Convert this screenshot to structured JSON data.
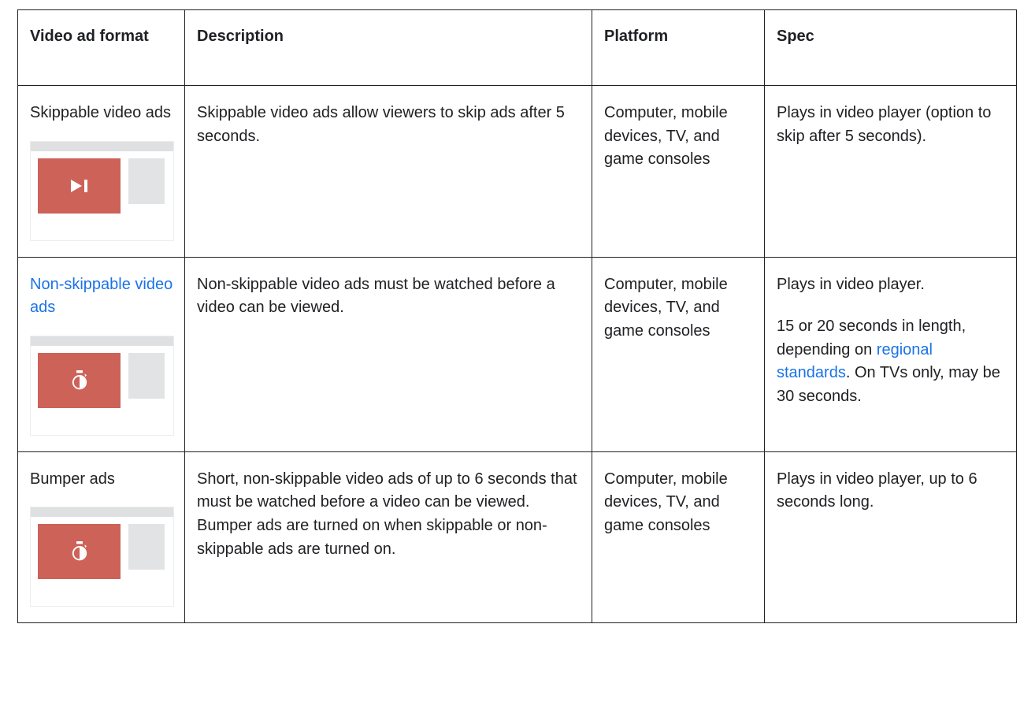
{
  "table": {
    "headers": [
      {
        "label": "Video ad format"
      },
      {
        "label": "Description"
      },
      {
        "label": "Platform"
      },
      {
        "label": "Spec"
      }
    ],
    "rows": [
      {
        "format_label": "Skippable video ads",
        "format_is_link": false,
        "thumbnail_icon": "skip-next-icon",
        "description": "Skippable video ads allow viewers to skip ads after 5 seconds.",
        "platform": "Computer, mobile devices, TV, and game consoles",
        "spec_paragraphs": [
          {
            "text": "Plays in video player (option to skip after 5 seconds)."
          }
        ]
      },
      {
        "format_label": "Non-skippable video ads",
        "format_is_link": true,
        "thumbnail_icon": "stopwatch-icon",
        "description": "Non-skippable video ads must be watched before a video can be viewed.",
        "platform": "Computer, mobile devices, TV, and game consoles",
        "spec_paragraphs": [
          {
            "text": "Plays in video player."
          },
          {
            "text_before": "15 or 20 seconds in length, depending on ",
            "link_text": "regional standards",
            "text_after": ". On TVs only, may be 30 seconds."
          }
        ]
      },
      {
        "format_label": "Bumper ads",
        "format_is_link": false,
        "thumbnail_icon": "stopwatch-icon",
        "description": "Short, non-skippable video ads of up to 6 seconds that must be watched before a video can be viewed. Bumper ads are turned on when skippable or non-skippable ads are turned on.",
        "platform": "Computer, mobile devices, TV, and game consoles",
        "spec_paragraphs": [
          {
            "text": "Plays in video player, up to 6 seconds long."
          }
        ]
      }
    ]
  },
  "colors": {
    "text": "#202124",
    "link": "#1a73e8",
    "thumb_video_red": "#cd6258",
    "thumb_side_gray": "#e2e3e4",
    "thumb_bar_gray": "#dfe0e1",
    "border": "#202124"
  }
}
